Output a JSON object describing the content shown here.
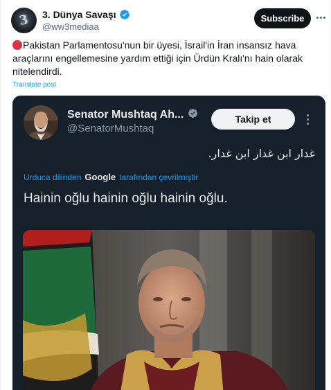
{
  "post": {
    "author_name": "3. Dünya Savaşı",
    "author_handle": "@ww3mediaa",
    "subscribe_label": "Subscribe",
    "text": "Pakistan Parlamentosu'nun bir üyesi, İsrail'in İran insansız hava araçlarını engellemesine yardım ettiği için Ürdün Kralı'nı hain olarak nitelendirdi.",
    "translate_label": "Translate post",
    "verified_color": "#1d9bf0",
    "icons": {
      "avatar": "ww3-logo-avatar",
      "verified": "verified-badge-icon",
      "more": "more-options-icon",
      "red_circle": "red-circle-emoji"
    }
  },
  "embedded": {
    "author_name": "Senator Mushtaq Ah...",
    "author_handle": "@SenatorMushtaq",
    "follow_label": "Takip et",
    "original_text": "غدار ابن غدار ابن غدار.",
    "translated_prefix": "Urduca dilinden",
    "translated_brand": "Google",
    "translated_suffix": "tarafından çevrilmiştir",
    "translation_text": "Hainin oğlu hainin oğlu hainin oğlu.",
    "background_color": "#15202b",
    "verified_color": "#8b98a5",
    "icons": {
      "avatar": "senator-avatar",
      "verified": "verified-badge-icon",
      "more": "more-options-icon",
      "photo": "king-portrait-photo"
    }
  }
}
